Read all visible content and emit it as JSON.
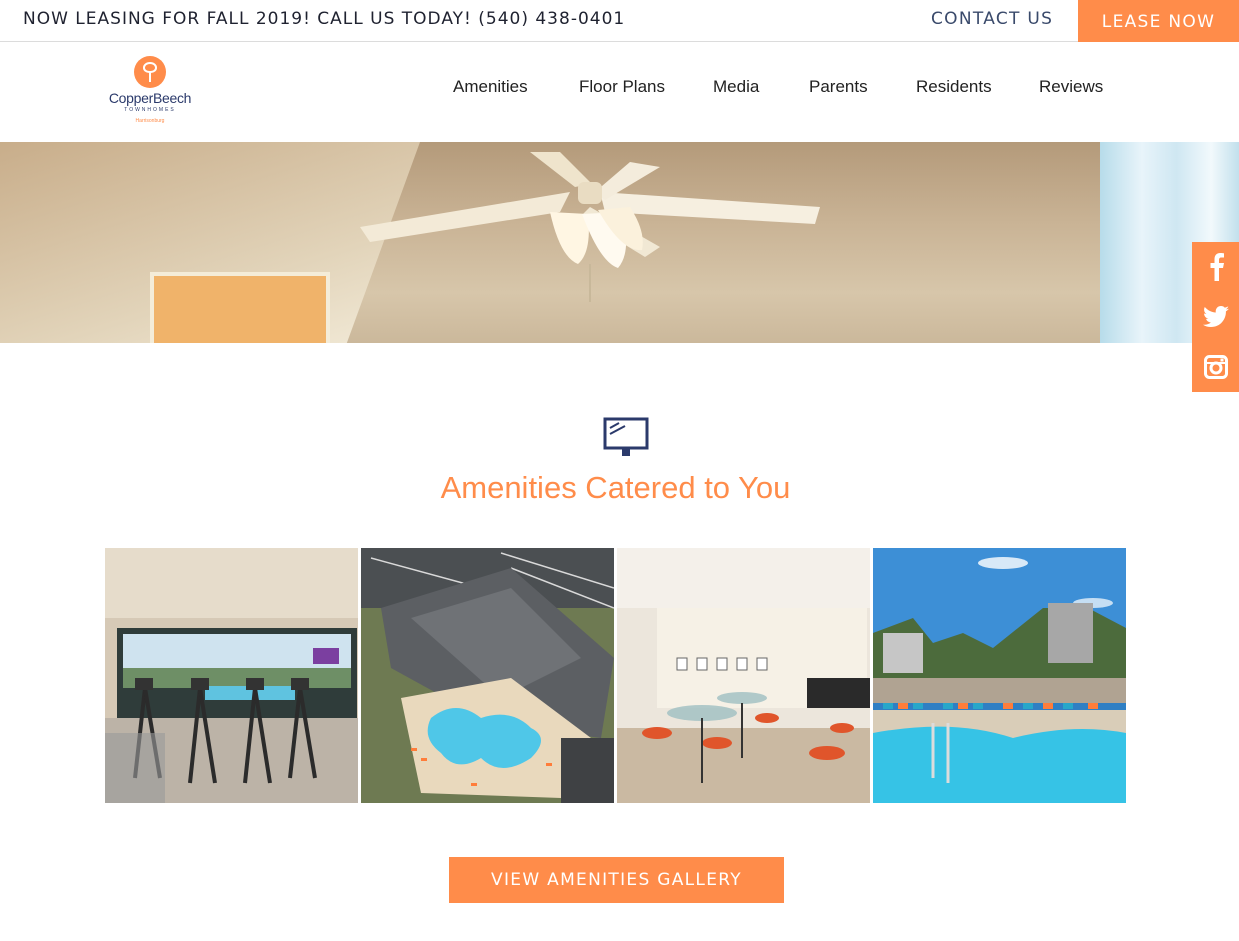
{
  "topbar": {
    "announcement": "NOW LEASING FOR FALL 2019! CALL US TODAY! (540) 438-0401",
    "contact_label": "CONTACT US",
    "lease_label": "LEASE NOW"
  },
  "logo": {
    "name": "CopperBeech",
    "subtitle": "TOWNHOMES",
    "city": "Harrisonburg"
  },
  "nav": {
    "items": [
      {
        "label": "Amenities"
      },
      {
        "label": "Floor Plans"
      },
      {
        "label": "Media"
      },
      {
        "label": "Parents"
      },
      {
        "label": "Residents"
      },
      {
        "label": "Reviews"
      }
    ]
  },
  "social": {
    "icons": [
      "facebook-icon",
      "twitter-icon",
      "instagram-icon"
    ]
  },
  "amenities": {
    "icon": "monitor-icon",
    "title": "Amenities Catered to You",
    "cta_label": "VIEW AMENITIES GALLERY",
    "photos": [
      "fitness-center",
      "aerial-clubhouse-pool",
      "game-lounge",
      "pool-deck"
    ]
  },
  "colors": {
    "accent": "#ff8c4a",
    "navy": "#2b3a6b",
    "text": "#222222"
  }
}
